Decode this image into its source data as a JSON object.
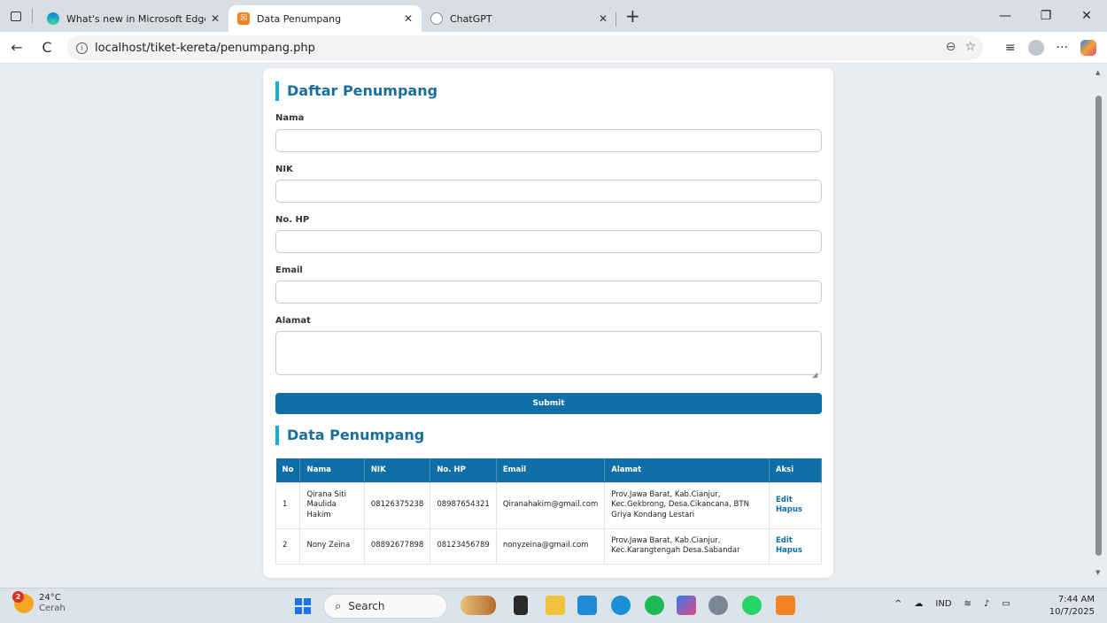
{
  "browser": {
    "tabs": [
      {
        "label": "What's new in Microsoft Edge",
        "close": "✕"
      },
      {
        "label": "Data Penumpang",
        "close": "✕",
        "favicon": "☒"
      },
      {
        "label": "ChatGPT",
        "close": "✕"
      }
    ],
    "new_tab": "+",
    "window_controls": {
      "minimize": "—",
      "restore": "❐",
      "close": "✕"
    },
    "back": "←",
    "reload": "C",
    "url": "localhost/tiket-kereta/penumpang.php",
    "more": "···"
  },
  "form": {
    "title": "Daftar Penumpang",
    "fields": [
      {
        "label": "Nama",
        "value": ""
      },
      {
        "label": "NIK",
        "value": ""
      },
      {
        "label": "No. HP",
        "value": ""
      },
      {
        "label": "Email",
        "value": ""
      },
      {
        "label": "Alamat",
        "value": ""
      }
    ],
    "submit_label": "Submit"
  },
  "table": {
    "title": "Data Penumpang",
    "headers": [
      "No",
      "Nama",
      "NIK",
      "No. HP",
      "Email",
      "Alamat",
      "Aksi"
    ],
    "rows": [
      {
        "no": "1",
        "nama": "Qirana Siti Maulida Hakim",
        "nik": "08126375238",
        "hp": "08987654321",
        "email": "Qiranahakim@gmail.com",
        "alamat": "Prov.Jawa Barat, Kab.Cianjur, Kec.Gekbrong, Desa.Cikancana, BTN Griya Kondang Lestari",
        "edit": "Edit",
        "hapus": "Hapus"
      },
      {
        "no": "2",
        "nama": "Nony Zeina",
        "nik": "08892677898",
        "hp": "08123456789",
        "email": "nonyzeina@gmail.com",
        "alamat": "Prov.Jawa Barat, Kab.Cianjur, Kec.Karangtengah Desa.Sabandar",
        "edit": "Edit",
        "hapus": "Hapus"
      }
    ]
  },
  "taskbar": {
    "weather_temp": "24°C",
    "weather_cond": "Cerah",
    "weather_badge": "2",
    "search_placeholder": "Search",
    "language": "IND",
    "time": "7:44 AM",
    "date": "10/7/2025"
  },
  "colors": {
    "accent": "#0f6fa6",
    "title": "#1a6e9c",
    "title_bar": "#18a9e0"
  }
}
